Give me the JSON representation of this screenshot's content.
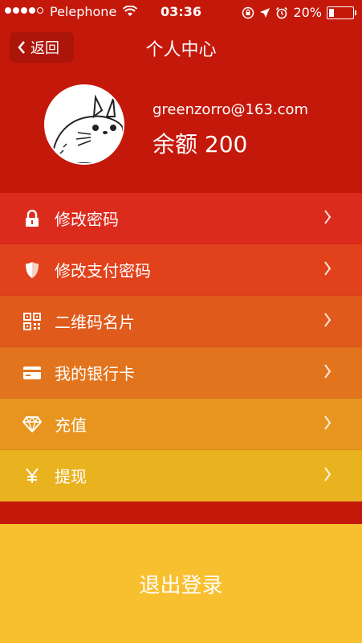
{
  "status_bar": {
    "carrier": "Pelephone",
    "time": "03:36",
    "battery": "20%",
    "battery_level": 0.2
  },
  "nav": {
    "back_label": "返回",
    "title": "个人中心"
  },
  "profile": {
    "email": "greenzorro@163.com",
    "balance": "余额 200"
  },
  "menu": {
    "items": [
      {
        "label": "修改密码",
        "icon": "lock-icon",
        "color": "#db2b1d"
      },
      {
        "label": "修改支付密码",
        "icon": "shield-icon",
        "color": "#e1421b"
      },
      {
        "label": "二维码名片",
        "icon": "qr-code-icon",
        "color": "#e05a1c"
      },
      {
        "label": "我的银行卡",
        "icon": "bank-card-icon",
        "color": "#e3741e"
      },
      {
        "label": "充值",
        "icon": "diamond-icon",
        "color": "#e7951f"
      },
      {
        "label": "提现",
        "icon": "yen-icon",
        "color": "#e9b21f"
      }
    ]
  },
  "logout_label": "退出登录",
  "colors": {
    "header_bg": "#c4180b",
    "logout_bg": "#f8bf2f"
  }
}
